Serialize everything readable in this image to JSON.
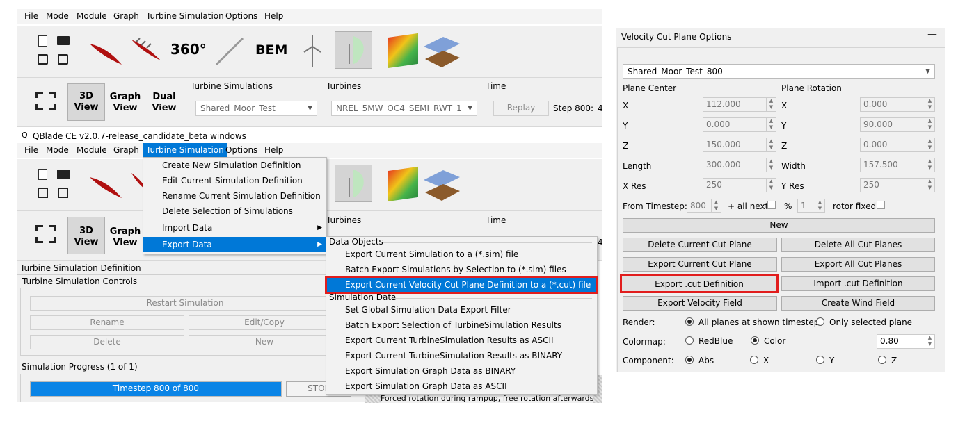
{
  "top_window": {
    "menu": [
      "File",
      "Mode",
      "Module",
      "Graph",
      "Turbine Simulation",
      "Options",
      "Help"
    ],
    "toolbar_text": {
      "t360": "360°",
      "bem": "BEM"
    },
    "view_buttons": {
      "three_d": "3D",
      "three_d2": "View",
      "graph": "Graph",
      "graph2": "View",
      "dual": "Dual",
      "dual2": "View"
    },
    "labels": {
      "sims": "Turbine Simulations",
      "turbines": "Turbines",
      "time": "Time"
    },
    "sim_combo": "Shared_Moor_Test",
    "turbine_combo": "NREL_5MW_OC4_SEMI_RWT_1",
    "replay": "Replay",
    "step": "Step 800:",
    "step_tail": "4"
  },
  "second_window": {
    "title": "QBlade CE v2.0.7-release_candidate_beta windows",
    "menu": [
      "File",
      "Mode",
      "Module",
      "Graph",
      "Turbine Simulation",
      "Options",
      "Help"
    ],
    "view_buttons": {
      "three_d": "3D",
      "three_d2": "View",
      "graph": "Graph",
      "graph2": "View"
    },
    "labels": {
      "turbines": "Turbines",
      "time": "Time",
      "time_tail": "4"
    },
    "panel_title": "Turbine Simulation Definition",
    "controls_title": "Turbine Simulation Controls",
    "restart": "Restart Simulation",
    "rename": "Rename",
    "editcopy": "Edit/Copy",
    "delete": "Delete",
    "new": "New",
    "progress_label": "Simulation Progress (1 of 1)",
    "progress_text": "Timestep 800 of 800",
    "progress_fraction": 1.0,
    "stop": "STOP",
    "footer_text": "Forced rotation during rampup, free rotation afterwards"
  },
  "dropdown_menu": {
    "items": [
      "Create New Simulation Definition",
      "Edit Current Simulation Definition",
      "Rename Current Simulation Definition",
      "Delete Selection of Simulations",
      "Import Data",
      "Export Data"
    ]
  },
  "submenu": {
    "section1": "Data Objects",
    "item1": "Export Current Simulation to a (*.sim) file",
    "item2": "Batch Export Simulations by Selection to (*.sim) files",
    "item3": "Export Current Velocity Cut Plane Definition to a (*.cut) file",
    "section2": "Simulation Data",
    "item4": "Set Global Simulation Data Export Filter",
    "item5": "Batch Export Selection of TurbineSimulation Results",
    "item6": "Export Current TurbineSimulation Results as ASCII",
    "item7": "Export Current TurbineSimulation Results as BINARY",
    "item8": "Export Simulation Graph Data as BINARY",
    "item9": "Export Simulation Graph Data as ASCII"
  },
  "cut_panel": {
    "title": "Velocity Cut Plane Options",
    "collapse": "—",
    "combo": "Shared_Moor_Test_800",
    "plane_center": "Plane Center",
    "plane_rotation": "Plane Rotation",
    "rows": [
      {
        "l1": "X",
        "v1": "112.000",
        "l2": "X",
        "v2": "0.000"
      },
      {
        "l1": "Y",
        "v1": "0.000",
        "l2": "Y",
        "v2": "90.000"
      },
      {
        "l1": "Z",
        "v1": "150.000",
        "l2": "Z",
        "v2": "0.000"
      },
      {
        "l1": "Length",
        "v1": "300.000",
        "l2": "Width",
        "v2": "157.500"
      },
      {
        "l1": "X Res",
        "v1": "250",
        "l2": "Y Res",
        "v2": "250"
      }
    ],
    "from_timestep": "From Timestep:",
    "timestep_val": "800",
    "all_next": "+ all next",
    "pct": "%",
    "pct_val": "1",
    "rotor_fixed": "rotor fixed",
    "new": "New",
    "delete_current": "Delete Current Cut Plane",
    "delete_all": "Delete All Cut Planes",
    "export_current": "Export Current Cut Plane",
    "export_all": "Export All Cut Planes",
    "export_def": "Export .cut Definition",
    "import_def": "Import .cut Definition",
    "export_field": "Export Velocity Field",
    "create_wind": "Create Wind Field",
    "render": "Render:",
    "render_opt1": "All planes at shown timestep",
    "render_opt2": "Only selected plane",
    "colormap": "Colormap:",
    "cm_opt1": "RedBlue",
    "cm_opt2": "Color",
    "cm_val": "0.80",
    "component": "Component:",
    "comp_abs": "Abs",
    "comp_x": "X",
    "comp_y": "Y",
    "comp_z": "Z"
  },
  "colors": {
    "highlight": "#0078d7",
    "red_box": "#e11d1d",
    "progress": "#0a84e6"
  }
}
